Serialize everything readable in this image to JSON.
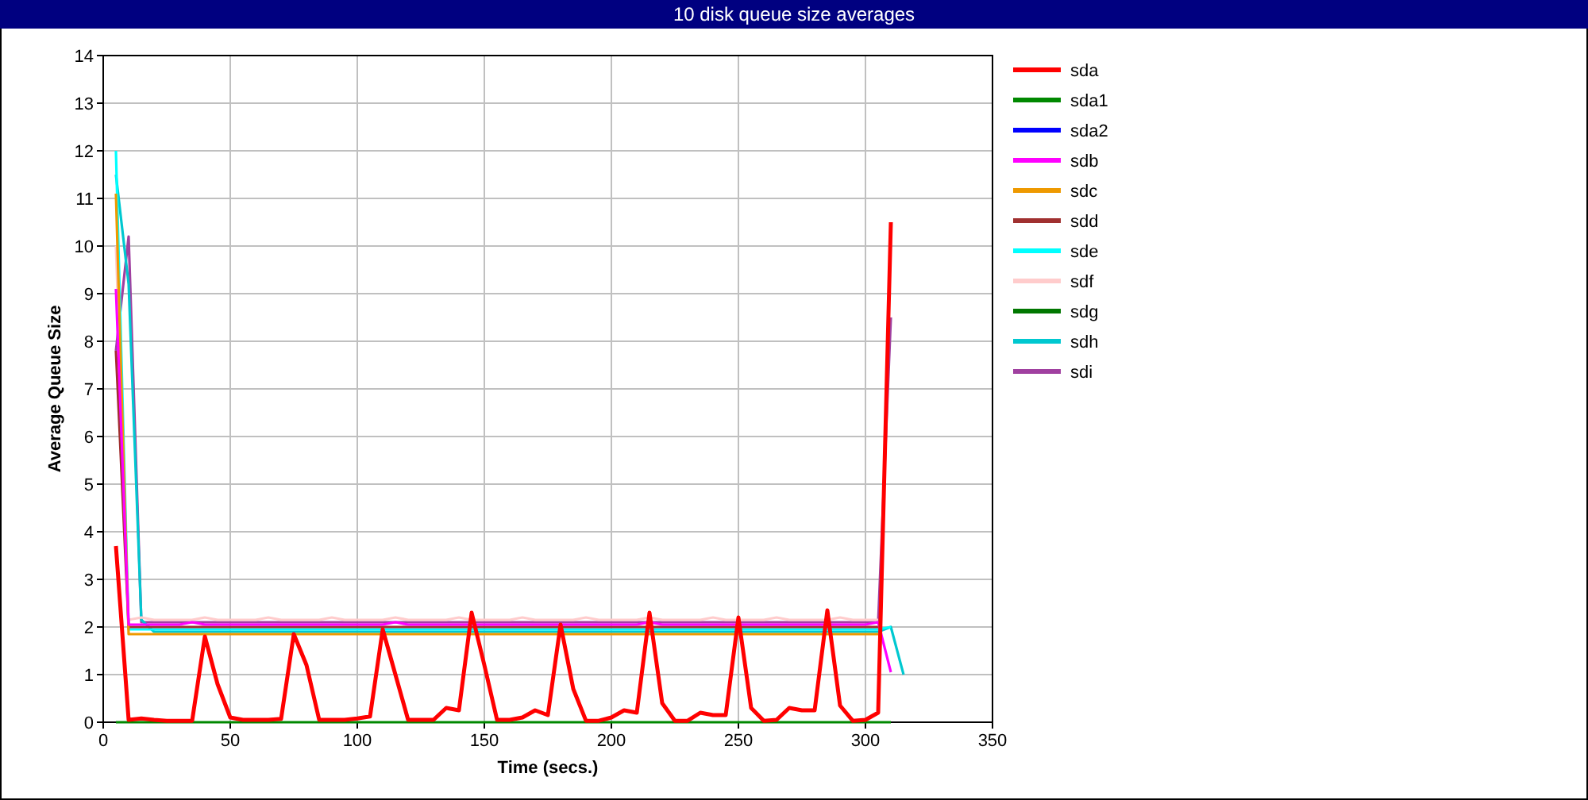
{
  "window": {
    "title": "10 disk queue size averages"
  },
  "chart_data": {
    "type": "line",
    "xlabel": "Time (secs.)",
    "ylabel": "Average Queue Size",
    "xlim": [
      0,
      350
    ],
    "ylim": [
      0,
      14
    ],
    "grid": true,
    "legend": true,
    "xticks": [
      0,
      50,
      100,
      150,
      200,
      250,
      300,
      350
    ],
    "yticks": [
      0,
      1,
      2,
      3,
      4,
      5,
      6,
      7,
      8,
      9,
      10,
      11,
      12,
      13,
      14
    ],
    "x": [
      5,
      10,
      15,
      20,
      25,
      30,
      35,
      40,
      45,
      50,
      55,
      60,
      65,
      70,
      75,
      80,
      85,
      90,
      95,
      100,
      105,
      110,
      115,
      120,
      125,
      130,
      135,
      140,
      145,
      150,
      155,
      160,
      165,
      170,
      175,
      180,
      185,
      190,
      195,
      200,
      205,
      210,
      215,
      220,
      225,
      230,
      235,
      240,
      245,
      250,
      255,
      260,
      265,
      270,
      275,
      280,
      285,
      290,
      295,
      300,
      305,
      310,
      315
    ],
    "series": [
      {
        "name": "sda",
        "color": "#ff0000",
        "values": [
          3.7,
          0.05,
          0.08,
          0.05,
          0.03,
          0.03,
          0.03,
          1.8,
          0.8,
          0.1,
          0.05,
          0.05,
          0.05,
          0.07,
          1.85,
          1.2,
          0.05,
          0.05,
          0.05,
          0.08,
          0.12,
          1.95,
          1.0,
          0.05,
          0.05,
          0.05,
          0.3,
          0.25,
          2.3,
          1.2,
          0.05,
          0.05,
          0.1,
          0.25,
          0.15,
          2.05,
          0.7,
          0.03,
          0.03,
          0.1,
          0.25,
          0.2,
          2.3,
          0.4,
          0.03,
          0.03,
          0.2,
          0.15,
          0.15,
          2.2,
          0.3,
          0.03,
          0.05,
          0.3,
          0.25,
          0.25,
          2.35,
          0.35,
          0.03,
          0.05,
          0.2,
          10.5,
          null
        ]
      },
      {
        "name": "sda1",
        "color": "#008800",
        "values": [
          0,
          0,
          0,
          0,
          0,
          0,
          0,
          0,
          0,
          0,
          0,
          0,
          0,
          0,
          0,
          0,
          0,
          0,
          0,
          0,
          0,
          0,
          0,
          0,
          0,
          0,
          0,
          0,
          0,
          0,
          0,
          0,
          0,
          0,
          0,
          0,
          0,
          0,
          0,
          0,
          0,
          0,
          0,
          0,
          0,
          0,
          0,
          0,
          0,
          0,
          0,
          0,
          0,
          0,
          0,
          0,
          0,
          0,
          0,
          0,
          0,
          0,
          null
        ]
      },
      {
        "name": "sda2",
        "color": "#0000ff",
        "values": [
          null,
          null,
          null,
          null,
          null,
          null,
          null,
          null,
          null,
          null,
          null,
          null,
          null,
          null,
          null,
          null,
          null,
          null,
          null,
          null,
          null,
          null,
          null,
          null,
          null,
          null,
          null,
          null,
          null,
          null,
          null,
          null,
          null,
          null,
          null,
          null,
          null,
          null,
          null,
          null,
          null,
          null,
          null,
          null,
          null,
          null,
          null,
          null,
          null,
          null,
          null,
          null,
          null,
          null,
          null,
          null,
          null,
          null,
          null,
          null,
          null,
          null,
          null
        ]
      },
      {
        "name": "sdb",
        "color": "#ff00ff",
        "values": [
          9.1,
          2.05,
          2.05,
          2.05,
          2.05,
          2.05,
          2.1,
          2.05,
          2.05,
          2.05,
          2.05,
          2.05,
          2.05,
          2.05,
          2.05,
          2.05,
          2.05,
          2.05,
          2.05,
          2.05,
          2.05,
          2.05,
          2.1,
          2.05,
          2.05,
          2.05,
          2.05,
          2.05,
          2.05,
          2.05,
          2.05,
          2.05,
          2.05,
          2.05,
          2.05,
          2.05,
          2.05,
          2.05,
          2.05,
          2.05,
          2.05,
          2.05,
          2.1,
          2.05,
          2.05,
          2.05,
          2.05,
          2.05,
          2.05,
          2.05,
          2.05,
          2.05,
          2.05,
          2.05,
          2.05,
          2.05,
          2.05,
          2.05,
          2.05,
          2.05,
          2.1,
          1.05,
          null
        ]
      },
      {
        "name": "sdc",
        "color": "#ee9900",
        "values": [
          11.1,
          1.85,
          1.85,
          1.85,
          1.85,
          1.85,
          1.85,
          1.85,
          1.85,
          1.85,
          1.85,
          1.85,
          1.85,
          1.85,
          1.85,
          1.85,
          1.85,
          1.85,
          1.85,
          1.85,
          1.85,
          1.85,
          1.85,
          1.85,
          1.85,
          1.85,
          1.85,
          1.85,
          1.85,
          1.85,
          1.85,
          1.85,
          1.85,
          1.85,
          1.85,
          1.85,
          1.85,
          1.85,
          1.85,
          1.85,
          1.85,
          1.85,
          1.85,
          1.85,
          1.85,
          1.85,
          1.85,
          1.85,
          1.85,
          1.85,
          1.85,
          1.85,
          1.85,
          1.85,
          1.85,
          1.85,
          1.85,
          1.85,
          1.85,
          1.85,
          1.85,
          null,
          null
        ]
      },
      {
        "name": "sdd",
        "color": "#a03030",
        "values": [
          7.8,
          2.0,
          2.0,
          2.0,
          2.0,
          2.0,
          2.0,
          2.0,
          2.0,
          2.0,
          2.0,
          2.0,
          2.0,
          2.0,
          2.0,
          2.0,
          2.0,
          2.0,
          2.0,
          2.0,
          2.0,
          2.0,
          2.0,
          2.0,
          2.0,
          2.0,
          2.0,
          2.0,
          2.0,
          2.0,
          2.0,
          2.0,
          2.0,
          2.0,
          2.0,
          2.0,
          2.0,
          2.0,
          2.0,
          2.0,
          2.0,
          2.0,
          2.0,
          2.0,
          2.0,
          2.0,
          2.0,
          2.0,
          2.0,
          2.0,
          2.0,
          2.0,
          2.0,
          2.0,
          2.0,
          2.0,
          2.0,
          2.0,
          2.0,
          2.0,
          2.0,
          null,
          null
        ]
      },
      {
        "name": "sde",
        "color": "#00ffff",
        "values": [
          12.0,
          1.95,
          1.95,
          1.95,
          1.95,
          1.95,
          1.95,
          1.95,
          1.95,
          1.95,
          1.95,
          1.95,
          1.95,
          1.95,
          1.95,
          1.95,
          1.95,
          1.95,
          1.95,
          1.95,
          1.95,
          1.95,
          1.95,
          1.95,
          1.95,
          1.95,
          1.95,
          1.95,
          1.95,
          1.95,
          1.95,
          1.95,
          1.95,
          1.95,
          1.95,
          1.95,
          1.95,
          1.95,
          1.95,
          1.95,
          1.95,
          1.95,
          1.95,
          1.95,
          1.95,
          1.95,
          1.95,
          1.95,
          1.95,
          1.95,
          1.95,
          1.95,
          1.95,
          1.95,
          1.95,
          1.95,
          1.95,
          1.95,
          1.95,
          1.95,
          1.95,
          2.0,
          null
        ]
      },
      {
        "name": "sdf",
        "color": "#ffcccc",
        "values": [
          10.0,
          2.15,
          2.2,
          2.15,
          2.15,
          2.15,
          2.15,
          2.2,
          2.15,
          2.15,
          2.15,
          2.15,
          2.2,
          2.15,
          2.15,
          2.15,
          2.15,
          2.2,
          2.15,
          2.15,
          2.15,
          2.15,
          2.2,
          2.15,
          2.15,
          2.15,
          2.15,
          2.2,
          2.15,
          2.15,
          2.15,
          2.15,
          2.2,
          2.15,
          2.15,
          2.15,
          2.15,
          2.2,
          2.15,
          2.15,
          2.15,
          2.15,
          2.2,
          2.15,
          2.15,
          2.15,
          2.15,
          2.2,
          2.15,
          2.15,
          2.15,
          2.15,
          2.2,
          2.15,
          2.15,
          2.15,
          2.15,
          2.2,
          2.15,
          2.15,
          2.15,
          null,
          null
        ]
      },
      {
        "name": "sdg",
        "color": "#007700",
        "values": [
          null,
          null,
          null,
          null,
          null,
          null,
          null,
          null,
          null,
          null,
          null,
          null,
          null,
          null,
          null,
          null,
          null,
          null,
          null,
          null,
          null,
          null,
          null,
          null,
          null,
          null,
          null,
          null,
          null,
          null,
          null,
          null,
          null,
          null,
          null,
          null,
          null,
          null,
          null,
          null,
          null,
          null,
          null,
          null,
          null,
          null,
          null,
          null,
          null,
          null,
          null,
          null,
          null,
          null,
          null,
          null,
          null,
          null,
          null,
          null,
          null,
          null,
          null
        ]
      },
      {
        "name": "sdh",
        "color": "#00c8d0",
        "values": [
          11.5,
          9.2,
          2.15,
          1.9,
          1.9,
          1.9,
          1.9,
          1.9,
          1.9,
          1.9,
          1.9,
          1.9,
          1.9,
          1.9,
          1.9,
          1.9,
          1.9,
          1.9,
          1.9,
          1.9,
          1.9,
          1.9,
          1.9,
          1.9,
          1.9,
          1.9,
          1.9,
          1.9,
          1.9,
          1.9,
          1.9,
          1.9,
          1.9,
          1.9,
          1.9,
          1.9,
          1.9,
          1.9,
          1.9,
          1.9,
          1.9,
          1.9,
          1.9,
          1.9,
          1.9,
          1.9,
          1.9,
          1.9,
          1.9,
          1.9,
          1.9,
          1.9,
          1.9,
          1.9,
          1.9,
          1.9,
          1.9,
          1.9,
          1.9,
          1.9,
          1.9,
          2.0,
          1.0
        ]
      },
      {
        "name": "sdi",
        "color": "#a040a0",
        "values": [
          7.8,
          10.2,
          2.1,
          2.1,
          2.1,
          2.1,
          2.1,
          2.1,
          2.1,
          2.1,
          2.1,
          2.1,
          2.1,
          2.1,
          2.1,
          2.1,
          2.1,
          2.1,
          2.1,
          2.1,
          2.1,
          2.1,
          2.1,
          2.1,
          2.1,
          2.1,
          2.1,
          2.1,
          2.1,
          2.1,
          2.1,
          2.1,
          2.1,
          2.1,
          2.1,
          2.1,
          2.1,
          2.1,
          2.1,
          2.1,
          2.1,
          2.1,
          2.1,
          2.1,
          2.1,
          2.1,
          2.1,
          2.1,
          2.1,
          2.1,
          2.1,
          2.1,
          2.1,
          2.1,
          2.1,
          2.1,
          2.1,
          2.1,
          2.1,
          2.1,
          2.1,
          8.5,
          null
        ]
      }
    ]
  }
}
